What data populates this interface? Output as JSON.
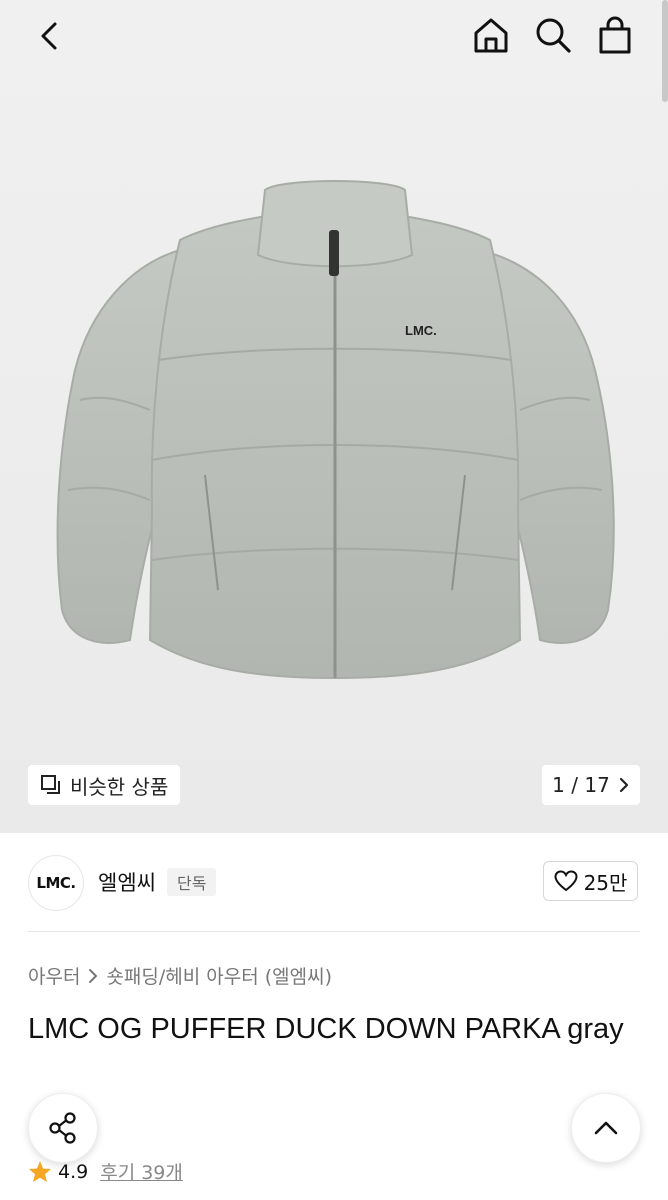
{
  "hero": {
    "jacket_logo": "LMC.",
    "similar_label": "비슷한 상품",
    "page_current": "1",
    "page_total": "17",
    "page_separator": " / "
  },
  "brand": {
    "logo_text": "LMC.",
    "name": "엘엠씨",
    "tag": "단독",
    "likes": "25만"
  },
  "product": {
    "breadcrumb": [
      "아우터",
      "숏패딩/헤비 아우터 (엘엠씨)"
    ],
    "title": "LMC OG PUFFER DUCK DOWN PARKA gray",
    "rating": "4.9",
    "reviews": "후기 39개"
  },
  "colors": {
    "star": "#f5a623",
    "jacket": "#b9bdb7",
    "background": "#eeeeee"
  },
  "icons": [
    "back-arrow-icon",
    "home-icon",
    "search-icon",
    "cart-icon",
    "similar-products-icon",
    "chevron-right-icon",
    "heart-icon",
    "share-icon",
    "chevron-up-icon",
    "star-icon"
  ]
}
